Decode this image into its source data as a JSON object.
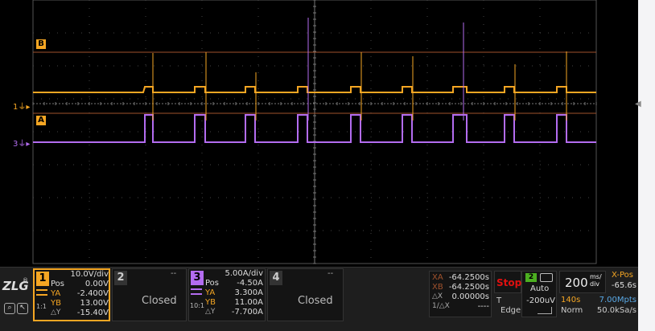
{
  "markers": {
    "b_label": "B",
    "a_label": "A",
    "ch1_marker": "1",
    "ch3_marker": "3"
  },
  "channels": [
    {
      "num": "1",
      "color": "#f5a623",
      "scale": "10.0V/div",
      "pos_label": "Pos",
      "pos": "0.00V",
      "ya_label": "YA",
      "ya": "-2.400V",
      "yb_label": "YB",
      "yb": "13.00V",
      "dy_label": "△Y",
      "dy": "-15.40V",
      "probe": "1:1"
    },
    {
      "num": "2",
      "status": "Closed",
      "top": "--"
    },
    {
      "num": "3",
      "color": "#b36cf0",
      "scale": "5.00A/div",
      "pos_label": "Pos",
      "pos": "-4.50A",
      "ya_label": "YA",
      "ya": "3.300A",
      "yb_label": "YB",
      "yb": "11.00A",
      "dy_label": "△Y",
      "dy": "-7.700A",
      "probe": "10:1"
    },
    {
      "num": "4",
      "status": "Closed",
      "top": "--"
    }
  ],
  "cursors": {
    "xa_label": "XA",
    "xa": "-64.2500s",
    "xb_label": "XB",
    "xb": "-64.2500s",
    "dx_label": "△X",
    "dx": "0.00000s",
    "inv_label": "1/△X",
    "inv": "----"
  },
  "trigger": {
    "run_state": "Stop",
    "source": "2",
    "mode": "Auto",
    "t_label": "T",
    "level": "-200uV",
    "type": "Edge"
  },
  "timebase": {
    "value": "200",
    "unit_top": "ms/",
    "unit_bottom": "div",
    "xpos_label": "X-Pos",
    "xpos": "-65.6s",
    "length": "140s",
    "mpts": "7.00Mpts",
    "acq": "Norm",
    "rate": "50.0kSa/s"
  },
  "colors": {
    "ch1": "#f5a623",
    "ch3": "#b36cf0",
    "run_stop": "#e01010",
    "grid": "#555555",
    "cursor_line": "#a0522d"
  }
}
